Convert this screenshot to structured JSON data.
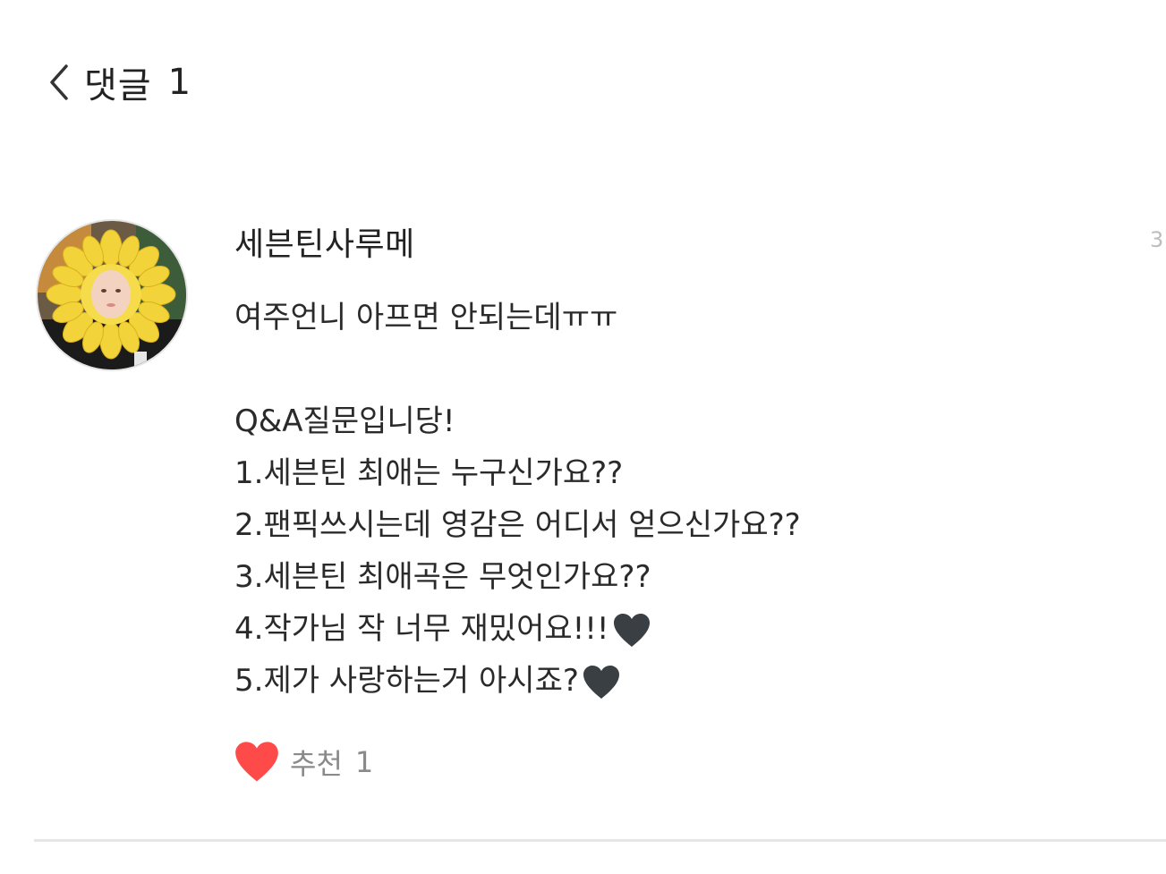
{
  "header": {
    "title": "댓글",
    "count": "1",
    "back_icon": "chevron-left-icon"
  },
  "comment": {
    "author": "세븐틴사루메",
    "date": "3",
    "lines": [
      "여주언니 아프면 안되는데ㅠㅠ",
      "",
      "Q&A질문입니당!",
      "1.세븐틴 최애는 누구신가요??",
      "2.팬픽쓰시는데 영감은 어디서 얻으신가요??",
      "3.세븐틴 최애곡은 무엇인가요??",
      "4.작가님 작 너무 재밌어요!!!",
      "5.제가 사랑하는거 아시죠?"
    ],
    "heart_icon_color": "#3a3f44"
  },
  "like": {
    "icon": "heart-icon",
    "color": "#ff4a4a",
    "label": "추천",
    "count": "1"
  }
}
